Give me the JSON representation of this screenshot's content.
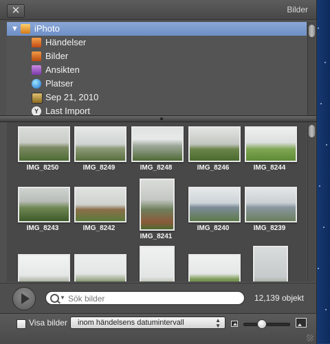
{
  "window": {
    "title": "Bilder",
    "close_glyph": "✕"
  },
  "source_list": {
    "root": {
      "label": "iPhoto",
      "icon": "iphoto-icon"
    },
    "items": [
      {
        "label": "Händelser",
        "icon": "events-icon"
      },
      {
        "label": "Bilder",
        "icon": "photos-icon"
      },
      {
        "label": "Ansikten",
        "icon": "faces-icon"
      },
      {
        "label": "Platser",
        "icon": "places-icon"
      },
      {
        "label": "Sep 21, 2010",
        "icon": "event-album-icon"
      },
      {
        "label": "Last Import",
        "icon": "last-import-icon"
      }
    ]
  },
  "photos": [
    {
      "name": "IMG_8250"
    },
    {
      "name": "IMG_8249"
    },
    {
      "name": "IMG_8248"
    },
    {
      "name": "IMG_8246"
    },
    {
      "name": "IMG_8244"
    },
    {
      "name": "IMG_8243"
    },
    {
      "name": "IMG_8242"
    },
    {
      "name": "IMG_8241"
    },
    {
      "name": "IMG_8240"
    },
    {
      "name": "IMG_8239"
    }
  ],
  "search": {
    "placeholder": "Sök bilder"
  },
  "status": {
    "count": "12,139 objekt"
  },
  "footer": {
    "show_label": "Visa bilder",
    "filter_value": "inom händelsens datumintervall"
  },
  "zoom": {
    "level": 0.4
  },
  "colors": {
    "selection": "#7a99cc",
    "panel": "#505050",
    "desktop": "#1d3f78"
  }
}
